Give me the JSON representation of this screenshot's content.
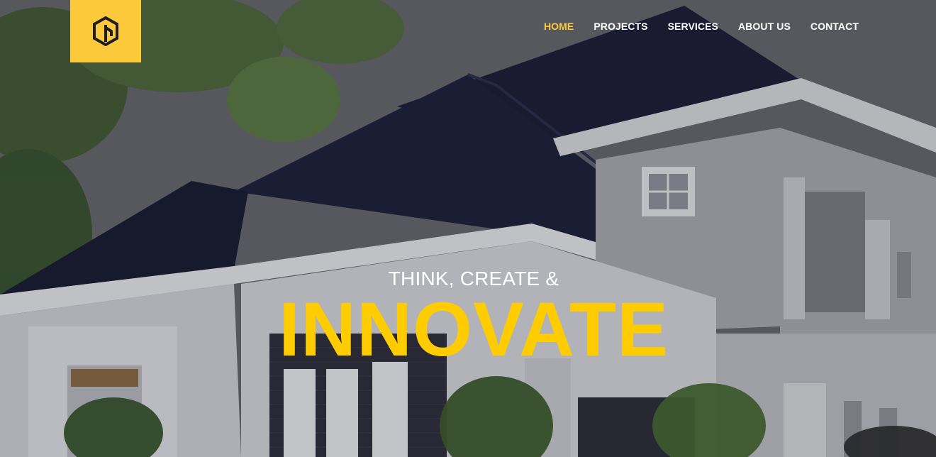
{
  "colors": {
    "accent": "#fcc93b",
    "headline": "#ffcc00",
    "nav_text": "#ffffff",
    "roof": "#1d1f3a",
    "wall": "#d9dbe0"
  },
  "logo": {
    "icon": "hexagon-logo-icon"
  },
  "nav": {
    "items": [
      {
        "label": "HOME",
        "active": true
      },
      {
        "label": "PROJECTS",
        "active": false
      },
      {
        "label": "SERVICES",
        "active": false
      },
      {
        "label": "ABOUT US",
        "active": false
      },
      {
        "label": "CONTACT",
        "active": false
      }
    ]
  },
  "hero": {
    "tagline": "THINK, CREATE &",
    "headline": "INNOVATE"
  }
}
